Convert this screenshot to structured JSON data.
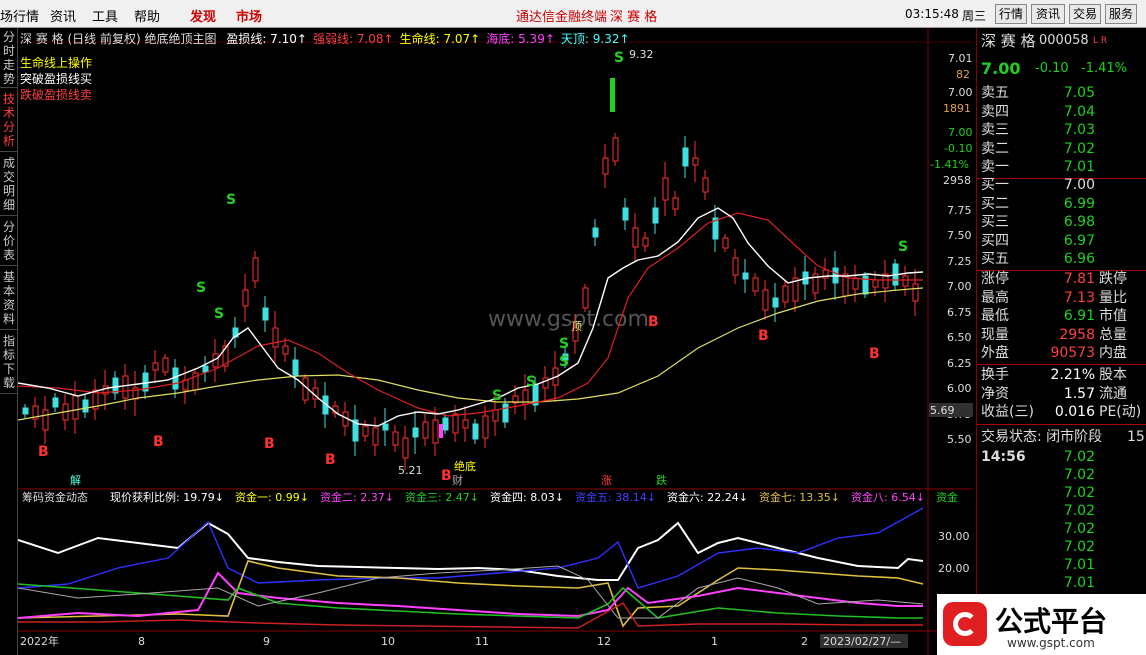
{
  "menubar": {
    "items": [
      "场行情",
      "资讯",
      "工具",
      "帮助",
      "发现",
      "市场"
    ],
    "center_title": "通达信金融终端",
    "stock_name": "深 赛 格",
    "time": "03:15:48",
    "weekday": "周三",
    "right_buttons": [
      "行情",
      "资讯",
      "交易",
      "服务"
    ]
  },
  "left_tabs": [
    "分时走势",
    "技术分析",
    "成交明细",
    "分价表",
    "基本资料",
    "指标下载"
  ],
  "chart_header": {
    "stock": "深 赛 格",
    "period": "(日线 前复权)",
    "indicator": "绝底绝顶主图",
    "items": [
      {
        "label": "盈损线",
        "value": "7.10",
        "color": "#ffffff"
      },
      {
        "label": "强弱线",
        "value": "7.08",
        "color": "#ff4040"
      },
      {
        "label": "生命线",
        "value": "7.07",
        "color": "#ffff00"
      },
      {
        "label": "海底",
        "value": "5.39",
        "color": "#ff40ff"
      },
      {
        "label": "天顶",
        "value": "9.32",
        "color": "#40ffff"
      }
    ],
    "legend": [
      "生命线上操作",
      "突破盈损线买",
      "跌破盈损线卖"
    ],
    "legend_colors": [
      "#ffff00",
      "#ffffff",
      "#ff4040"
    ]
  },
  "annotations": {
    "high_label": "9.32",
    "low_label": "5.21",
    "bottom_label": "绝底",
    "top_label": "顶",
    "cai_label": "财",
    "jie_label": "解",
    "zhang_label": "涨",
    "die_label": "跌",
    "watermark_text": "www.gspt.com",
    "b_marks": [
      "B",
      "B",
      "B",
      "B",
      "B",
      "B",
      "B",
      "B"
    ],
    "s_marks": [
      "S",
      "S",
      "S",
      "S",
      "S",
      "S",
      "S",
      "S",
      "S",
      "S"
    ]
  },
  "price_axis": {
    "labels": [
      "7.75",
      "7.50",
      "7.25",
      "7.00",
      "6.75",
      "6.50",
      "6.25",
      "6.00",
      "5.75",
      "5.50"
    ],
    "current": "5.69",
    "top_numbers": [
      "7.01",
      "82",
      "7.00",
      "1891",
      "7.00",
      "-0.10",
      "-1.41%",
      "2958"
    ]
  },
  "sub_chart": {
    "title": "筹码资金动态",
    "items": [
      {
        "label": "现价获利比例",
        "value": "19.79",
        "color": "#ffffff"
      },
      {
        "label": "资金一",
        "value": "0.99",
        "color": "#ffff00"
      },
      {
        "label": "资金二",
        "value": "2.37",
        "color": "#ff40ff"
      },
      {
        "label": "资金三",
        "value": "2.47",
        "color": "#20d020"
      },
      {
        "label": "资金四",
        "value": "8.03",
        "color": "#ffffff"
      },
      {
        "label": "资金五",
        "value": "38.14",
        "color": "#4040ff"
      },
      {
        "label": "资金六",
        "value": "22.24",
        "color": "#ffffff"
      },
      {
        "label": "资金七",
        "value": "13.35",
        "color": "#e0c040"
      },
      {
        "label": "资金八",
        "value": "6.54",
        "color": "#ff40ff"
      },
      {
        "label": "资金",
        "value": "",
        "color": "#20d020"
      }
    ],
    "axis": [
      "30.00",
      "20.00"
    ]
  },
  "time_axis": [
    "2022年",
    "8",
    "9",
    "10",
    "11",
    "12",
    "1",
    "2",
    "2023/02/27/—"
  ],
  "quote": {
    "name": "深 赛 格",
    "code": "000058",
    "flags": "L R",
    "price": "7.00",
    "change": "-0.10",
    "pct": "-1.41%",
    "asks": [
      {
        "label": "卖五",
        "price": "7.05"
      },
      {
        "label": "卖四",
        "price": "7.04"
      },
      {
        "label": "卖三",
        "price": "7.03"
      },
      {
        "label": "卖二",
        "price": "7.02"
      },
      {
        "label": "卖一",
        "price": "7.01"
      }
    ],
    "bids": [
      {
        "label": "买一",
        "price": "7.00"
      },
      {
        "label": "买二",
        "price": "6.99"
      },
      {
        "label": "买三",
        "price": "6.98"
      },
      {
        "label": "买四",
        "price": "6.97"
      },
      {
        "label": "买五",
        "price": "6.96"
      }
    ],
    "stats": [
      {
        "label": "涨停",
        "value": "7.81",
        "trail": "跌停",
        "color": "#ff4040"
      },
      {
        "label": "最高",
        "value": "7.13",
        "trail": "量比",
        "color": "#ff4040"
      },
      {
        "label": "最低",
        "value": "6.91",
        "trail": "市值",
        "color": "#20d020"
      },
      {
        "label": "现量",
        "value": "2958",
        "trail": "总量",
        "color": "#ff4040"
      },
      {
        "label": "外盘",
        "value": "90573",
        "trail": "内盘",
        "color": "#ff4040"
      }
    ],
    "stats2": [
      {
        "label": "换手",
        "value": "2.21%",
        "trail": "股本"
      },
      {
        "label": "净资",
        "value": "1.57",
        "trail": "流通"
      },
      {
        "label": "收益(三)",
        "value": "0.016",
        "trail": "PE(动)"
      }
    ],
    "trade_status": "交易状态: 闭市阶段",
    "trade_status_trail": "15:",
    "ticks_time": "14:56",
    "ticks": [
      "7.02",
      "7.02",
      "7.02",
      "7.02",
      "7.02",
      "7.02",
      "7.01",
      "7.01",
      "7.01"
    ]
  },
  "brand": {
    "name": "公式平台",
    "url": "www.gspt.com"
  }
}
